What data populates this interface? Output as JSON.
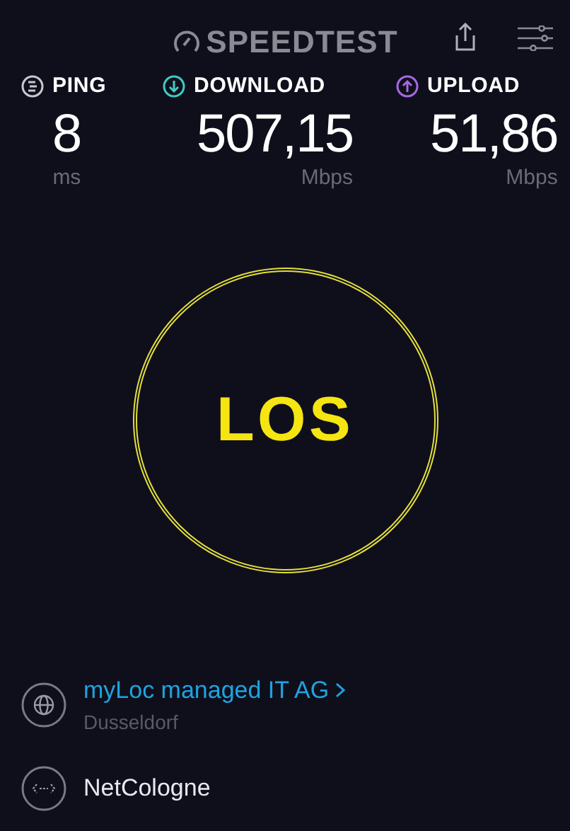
{
  "header": {
    "logo": "SPEEDTEST"
  },
  "metrics": [
    {
      "kind": "ping",
      "label": "PING",
      "value": "8",
      "unit": "ms",
      "color": "#c8c8d0"
    },
    {
      "kind": "download",
      "label": "DOWNLOAD",
      "value": "507,15",
      "unit": "Mbps",
      "color": "#3fcbc3"
    },
    {
      "kind": "upload",
      "label": "UPLOAD",
      "value": "51,86",
      "unit": "Mbps",
      "color": "#a36ae0"
    }
  ],
  "go_button": {
    "label": "LOS"
  },
  "server": {
    "name": "myLoc managed IT AG",
    "location": "Dusseldorf"
  },
  "provider": {
    "name": "NetCologne"
  }
}
